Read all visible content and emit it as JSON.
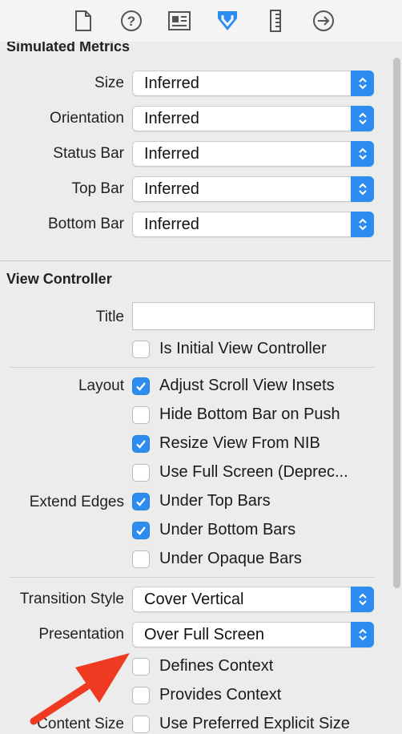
{
  "sections": {
    "simulated_metrics": "Simulated Metrics",
    "view_controller": "View Controller"
  },
  "metrics": {
    "size": {
      "label": "Size",
      "value": "Inferred"
    },
    "orientation": {
      "label": "Orientation",
      "value": "Inferred"
    },
    "status_bar": {
      "label": "Status Bar",
      "value": "Inferred"
    },
    "top_bar": {
      "label": "Top Bar",
      "value": "Inferred"
    },
    "bottom_bar": {
      "label": "Bottom Bar",
      "value": "Inferred"
    }
  },
  "vc": {
    "title_label": "Title",
    "title_value": "",
    "initial": {
      "label": "Is Initial View Controller",
      "checked": false
    },
    "layout_label": "Layout",
    "adjust_scroll": {
      "label": "Adjust Scroll View Insets",
      "checked": true
    },
    "hide_bottom": {
      "label": "Hide Bottom Bar on Push",
      "checked": false
    },
    "resize_nib": {
      "label": "Resize View From NIB",
      "checked": true
    },
    "full_screen": {
      "label": "Use Full Screen (Deprec...",
      "checked": false
    },
    "extend_edges_label": "Extend Edges",
    "under_top": {
      "label": "Under Top Bars",
      "checked": true
    },
    "under_bottom": {
      "label": "Under Bottom Bars",
      "checked": true
    },
    "under_opaque": {
      "label": "Under Opaque Bars",
      "checked": false
    },
    "transition": {
      "label": "Transition Style",
      "value": "Cover Vertical"
    },
    "presentation": {
      "label": "Presentation",
      "value": "Over Full Screen"
    },
    "defines_context": {
      "label": "Defines Context",
      "checked": false
    },
    "provides_context": {
      "label": "Provides Context",
      "checked": false
    },
    "content_size_label": "Content Size",
    "preferred_size": {
      "label": "Use Preferred Explicit Size",
      "checked": false
    }
  },
  "toolbar_icons": [
    "file-icon",
    "help-icon",
    "identity-icon",
    "attributes-icon",
    "size-ruler-icon",
    "connections-icon"
  ],
  "colors": {
    "accent": "#2d8cf0",
    "arrow": "#f03a22"
  }
}
